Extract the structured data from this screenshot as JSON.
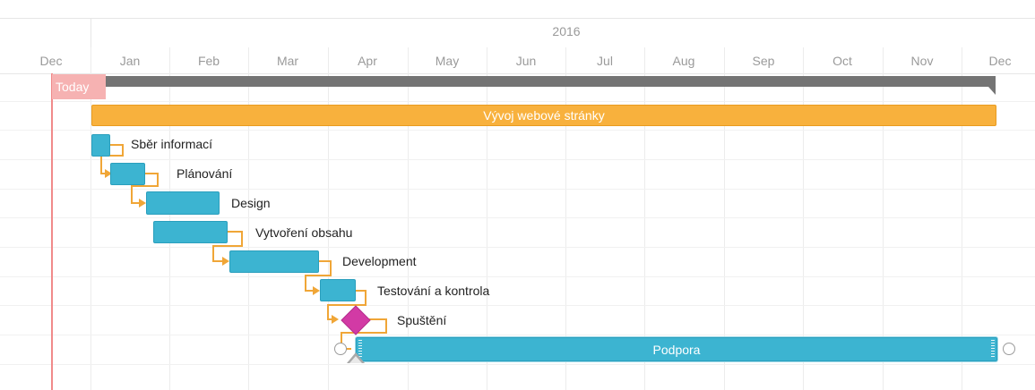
{
  "timeline": {
    "year_label": "2016",
    "today_label": "Today",
    "months": [
      "Dec",
      "Jan",
      "Feb",
      "Mar",
      "Apr",
      "May",
      "Jun",
      "Jul",
      "Aug",
      "Sep",
      "Oct",
      "Nov",
      "Dec"
    ]
  },
  "project": {
    "name": "Vývoj webové stránky"
  },
  "tasks": [
    {
      "label": "Sběr informací"
    },
    {
      "label": "Plánování"
    },
    {
      "label": "Design"
    },
    {
      "label": "Vytvoření obsahu"
    },
    {
      "label": "Development"
    },
    {
      "label": "Testování a kontrola"
    },
    {
      "label": "Spuštění"
    },
    {
      "label": "Podpora"
    }
  ],
  "colors": {
    "summary": "#747474",
    "project_bar": "#f8b13d",
    "task_bar": "#3cb4d1",
    "milestone": "#d23aa5",
    "link": "#f0a637",
    "today": "#f08a8a"
  }
}
